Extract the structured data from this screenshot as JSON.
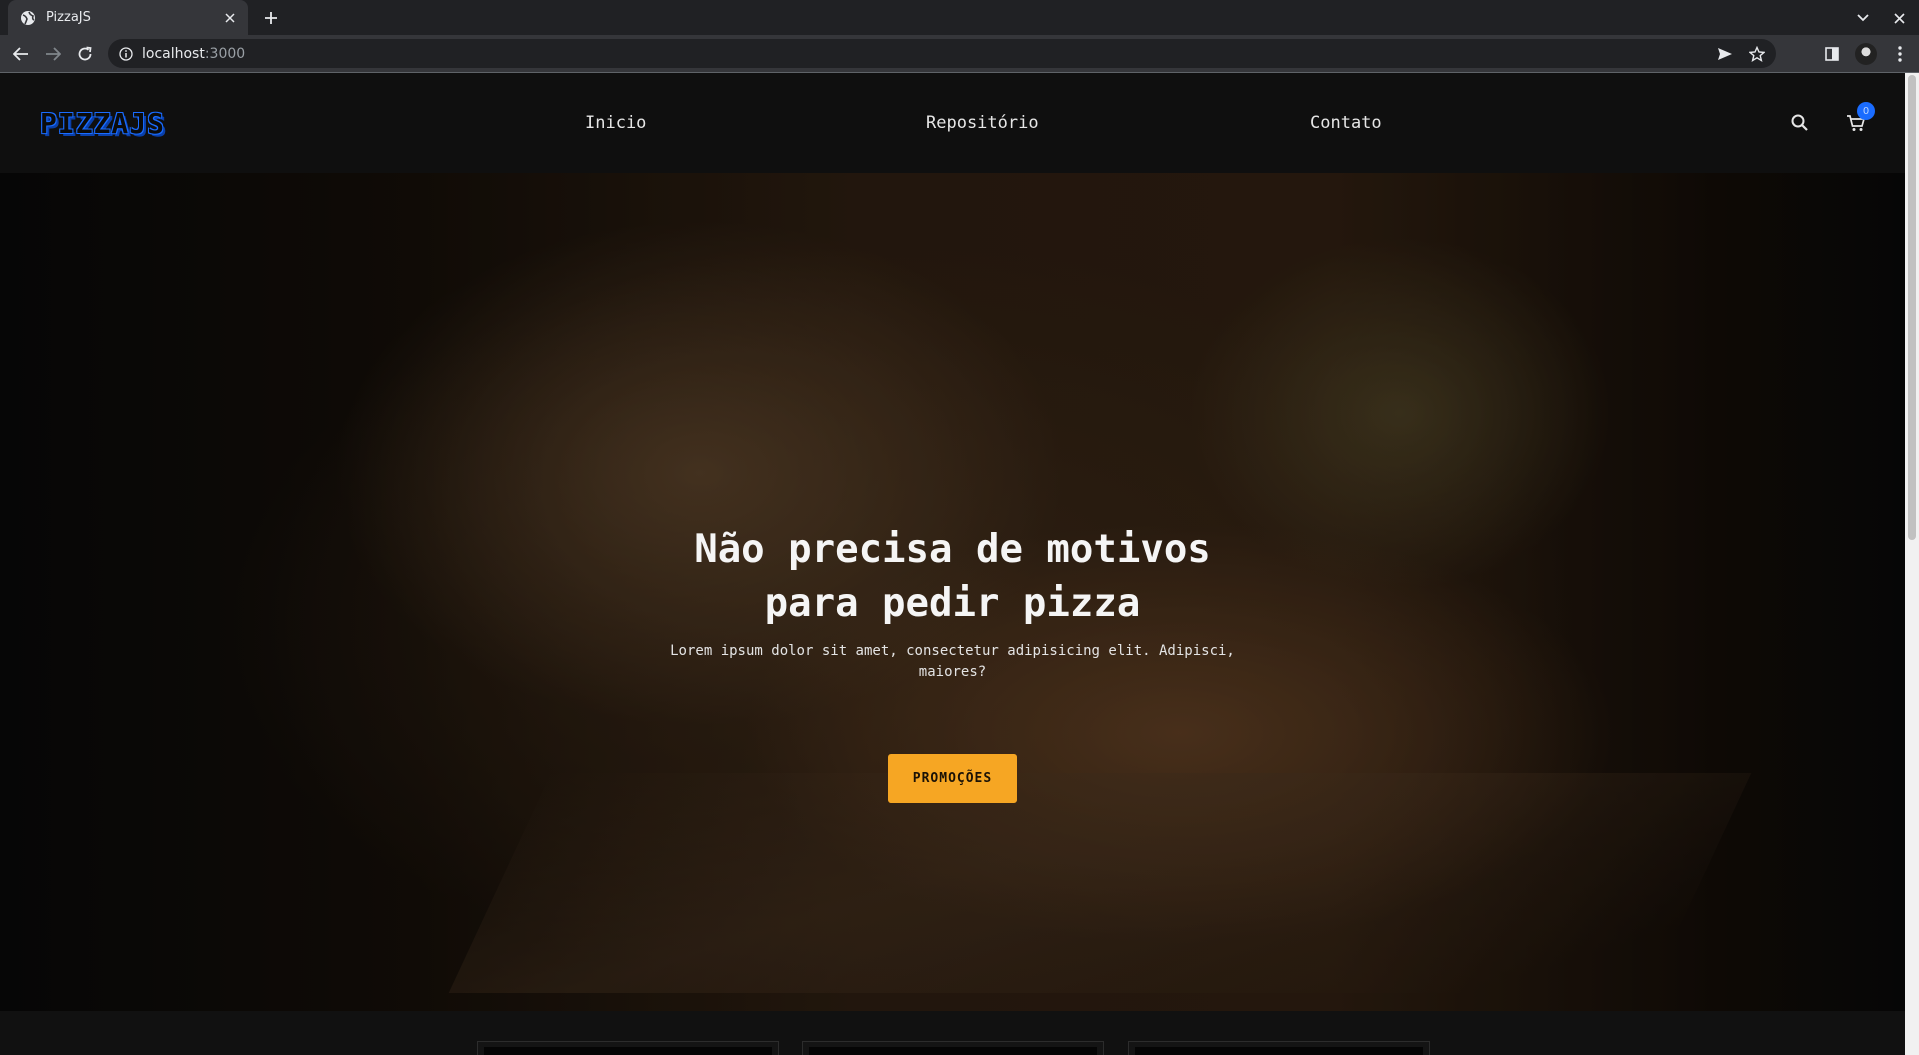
{
  "browser": {
    "tab_title": "PizzaJS",
    "url_host": "localhost",
    "url_port": ":3000"
  },
  "site": {
    "logo": "PIZZAJS",
    "nav": [
      "Inicio",
      "Repositório",
      "Contato"
    ],
    "cart_count": "0"
  },
  "hero": {
    "title_line1": "Não precisa de motivos",
    "title_line2": "para pedir pizza",
    "text": "Lorem ipsum dolor sit amet, consectetur adipisicing elit. Adipisci, maiores?",
    "cta": "PROMOÇÕES"
  },
  "colors": {
    "accent": "#f6a623",
    "logo_blue": "#1a6cff",
    "header_bg": "#0f0f0f"
  }
}
